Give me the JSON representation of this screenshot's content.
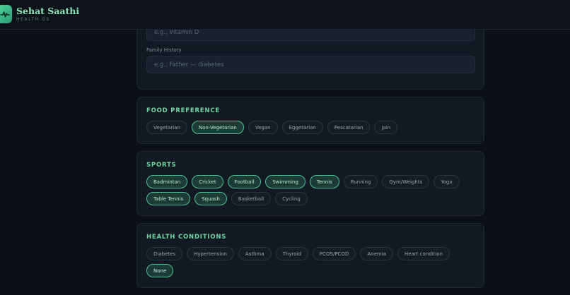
{
  "app": {
    "name": "Sehat Saathi",
    "subtitle": "HEALTH OS"
  },
  "colors": {
    "accent": "#6fd6a4",
    "background": "#0b1016",
    "card": "#111a22",
    "chip_active_border": "#4fc293"
  },
  "history": {
    "vitamin_placeholder": "e.g., Vitamin D",
    "family_label": "Family History",
    "family_placeholder": "e.g., Father — diabetes"
  },
  "food": {
    "title": "FOOD PREFERENCE",
    "options": [
      {
        "label": "Vegetarian",
        "selected": false
      },
      {
        "label": "Non-Vegetarian",
        "selected": true
      },
      {
        "label": "Vegan",
        "selected": false
      },
      {
        "label": "Eggetarian",
        "selected": false
      },
      {
        "label": "Pescatarian",
        "selected": false
      },
      {
        "label": "Jain",
        "selected": false
      }
    ]
  },
  "sports": {
    "title": "SPORTS",
    "options": [
      {
        "label": "Badminton",
        "selected": true
      },
      {
        "label": "Cricket",
        "selected": true
      },
      {
        "label": "Football",
        "selected": true
      },
      {
        "label": "Swimming",
        "selected": true
      },
      {
        "label": "Tennis",
        "selected": true
      },
      {
        "label": "Running",
        "selected": false
      },
      {
        "label": "Gym/Weights",
        "selected": false
      },
      {
        "label": "Yoga",
        "selected": false
      },
      {
        "label": "Table Tennis",
        "selected": true
      },
      {
        "label": "Squash",
        "selected": true
      },
      {
        "label": "Basketball",
        "selected": false
      },
      {
        "label": "Cycling",
        "selected": false
      }
    ]
  },
  "health": {
    "title": "HEALTH CONDITIONS",
    "options": [
      {
        "label": "Diabetes",
        "selected": false
      },
      {
        "label": "Hypertension",
        "selected": false
      },
      {
        "label": "Asthma",
        "selected": false
      },
      {
        "label": "Thyroid",
        "selected": false
      },
      {
        "label": "PCOS/PCOD",
        "selected": false
      },
      {
        "label": "Anemia",
        "selected": false
      },
      {
        "label": "Heart condition",
        "selected": false
      },
      {
        "label": "None",
        "selected": true
      }
    ]
  }
}
